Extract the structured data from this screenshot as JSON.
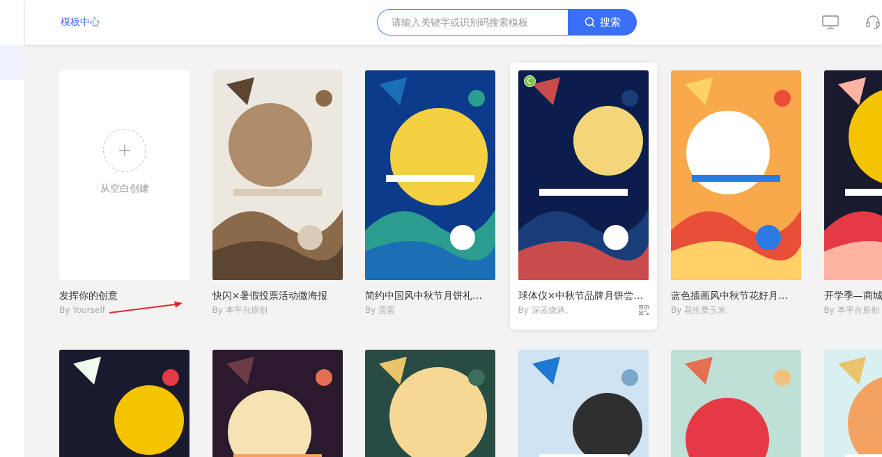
{
  "sidebar": {
    "items": [
      {
        "selected": true
      }
    ]
  },
  "header": {
    "brand": "模板中心",
    "search": {
      "placeholder": "请输入关键字或识别码搜索模板",
      "button": "搜索"
    }
  },
  "rows": [
    {
      "cards": [
        {
          "kind": "create",
          "label": "从空白创建",
          "title": "发挥你的创意",
          "author": "By Yourself",
          "hovered": false
        },
        {
          "kind": "template",
          "title": "快闪×暑假投票活动微海报",
          "author": "By 本平台原创",
          "hovered": false
        },
        {
          "kind": "template",
          "title": "简约中国风中秋节月饼礼…",
          "author": "By 蛮蛮",
          "hovered": false
        },
        {
          "kind": "template",
          "title": "球体仪×中秋节品牌月饼尝…",
          "author": "By 深蓝烧酒。",
          "hovered": true,
          "badge": "C"
        },
        {
          "kind": "template",
          "title": "蓝色插画风中秋节花好月…",
          "author": "By 花生爱玉米",
          "hovered": false
        },
        {
          "kind": "template",
          "title": "开学季—商城",
          "author": "By 本平台原创",
          "hovered": false
        }
      ]
    },
    {
      "cards": [
        {
          "kind": "picture"
        },
        {
          "kind": "picture"
        },
        {
          "kind": "picture"
        },
        {
          "kind": "picture"
        },
        {
          "kind": "picture"
        },
        {
          "kind": "picture"
        }
      ]
    }
  ]
}
